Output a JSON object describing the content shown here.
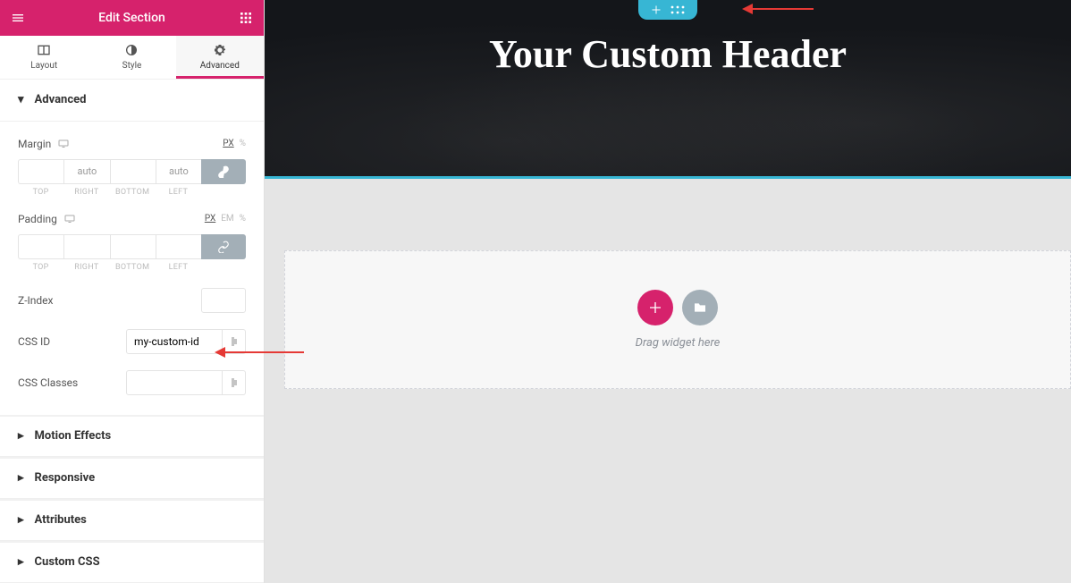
{
  "header": {
    "title": "Edit Section"
  },
  "tabs": {
    "layout": "Layout",
    "style": "Style",
    "advanced": "Advanced",
    "active": "advanced"
  },
  "sections": {
    "advanced": {
      "title": "Advanced",
      "margin": {
        "label": "Margin",
        "units": [
          "PX",
          "%"
        ],
        "active_unit": "PX",
        "top": "",
        "right": "auto",
        "bottom": "",
        "left": "auto",
        "sub": {
          "top": "TOP",
          "right": "RIGHT",
          "bottom": "BOTTOM",
          "left": "LEFT"
        }
      },
      "padding": {
        "label": "Padding",
        "units": [
          "PX",
          "EM",
          "%"
        ],
        "active_unit": "PX",
        "top": "",
        "right": "",
        "bottom": "",
        "left": "",
        "sub": {
          "top": "TOP",
          "right": "RIGHT",
          "bottom": "BOTTOM",
          "left": "LEFT"
        }
      },
      "zindex": {
        "label": "Z-Index",
        "value": ""
      },
      "css_id": {
        "label": "CSS ID",
        "value": "my-custom-id"
      },
      "css_classes": {
        "label": "CSS Classes",
        "value": ""
      }
    },
    "collapsed": [
      "Motion Effects",
      "Responsive",
      "Attributes",
      "Custom CSS"
    ]
  },
  "canvas": {
    "hero_title": "Your Custom Header",
    "dropzone_text": "Drag widget here"
  }
}
